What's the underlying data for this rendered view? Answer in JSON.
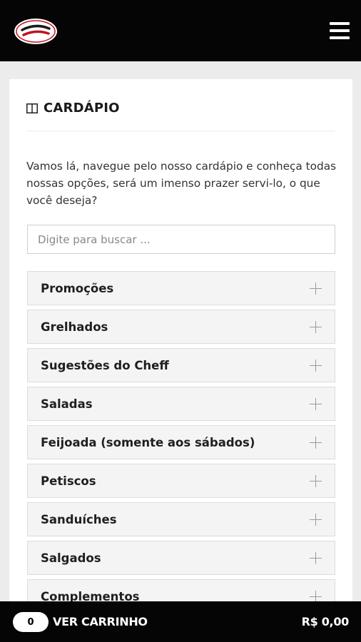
{
  "header": {
    "logo_icon": "restaurant-logo",
    "menu_icon": "hamburger-menu-icon"
  },
  "menu": {
    "heading_icon": "book-icon",
    "title": "CARDÁPIO",
    "intro": "Vamos lá, navegue pelo nosso cardápio e conheça todas nossas opções, será um imenso prazer servi-lo, o que você deseja?",
    "search_placeholder": "Digite para buscar ...",
    "categories": [
      "Promoções",
      "Grelhados",
      "Sugestões do Cheff",
      "Saladas",
      "Feijoada (somente aos sábados)",
      "Petiscos",
      "Sanduíches",
      "Salgados",
      "Complementos"
    ],
    "expand_icon": "plus-icon"
  },
  "cart": {
    "count": "0",
    "label": "VER CARRINHO",
    "total": "R$ 0,00"
  },
  "colors": {
    "bar": "#050505",
    "background": "#ececec",
    "card": "#ffffff",
    "category_bg": "#f4f4f4"
  }
}
